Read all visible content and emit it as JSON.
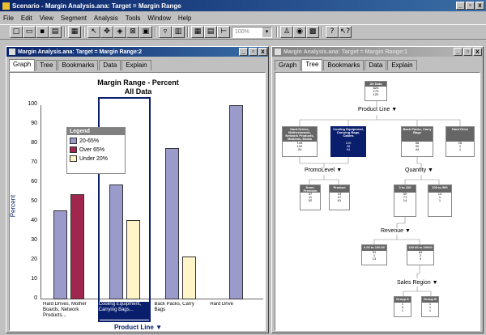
{
  "app": {
    "title": "Scenario - Margin Analysis.ana:  Target = Margin Range",
    "min": "_",
    "max": "▫",
    "close": "x"
  },
  "menu": [
    "File",
    "Edit",
    "View",
    "Segment",
    "Analysis",
    "Tools",
    "Window",
    "Help"
  ],
  "toolbar": {
    "zoom_value": "100%",
    "icons": [
      "new-icon",
      "open-icon",
      "save-icon",
      "print-icon",
      "copy-icon",
      "pointer-icon",
      "navigate-icon",
      "fit-icon",
      "zoom-icon",
      "image-icon",
      "filter-icon",
      "chart-icon",
      "grid-icon",
      "table-icon",
      "tree-icon",
      "people-icon",
      "target-icon",
      "analyze-icon",
      "help-icon",
      "context-help-icon"
    ]
  },
  "left": {
    "title": "Margin Analysis.ana:  Target = Margin Range:2",
    "tabs": [
      "Graph",
      "Tree",
      "Bookmarks",
      "Data",
      "Explain"
    ],
    "active_tab": "Graph",
    "chart_title": "Margin Range - Percent",
    "chart_subtitle": "All Data"
  },
  "right": {
    "title": "Margin Analysis.ana:  Target = Margin Range:1",
    "tabs": [
      "Graph",
      "Tree",
      "Bookmarks",
      "Data",
      "Explain"
    ],
    "active_tab": "Tree",
    "tree": {
      "root": {
        "title": "All Data",
        "v": [
          "824",
          "170",
          "120"
        ]
      },
      "split1": "Product Line",
      "n1": {
        "title": "Hard Drives, Motherboards, Network Products, Modems, Media Hardware",
        "v": [
          "144",
          "102",
          "24"
        ]
      },
      "n2": {
        "title": "Cooling Equipment, Carrying Bags, Cables",
        "v": [
          "120",
          "38",
          "94"
        ]
      },
      "n3": {
        "title": "Back Packs, Carry Bags",
        "v": [
          "56",
          "00",
          "44"
        ]
      },
      "n4": {
        "title": "Hard Drive",
        "v": [
          "26",
          "1",
          "1"
        ]
      },
      "split2a": "PromoLevel",
      "split2b": "Quantity",
      "n5": {
        "title": "None, Premium",
        "v": [
          "37",
          "11",
          "52"
        ]
      },
      "n6": {
        "title": "Product",
        "v": [
          "13",
          "27",
          "61"
        ]
      },
      "n7": {
        "title": "0 to 100",
        "v": [
          "50",
          "71",
          "14"
        ]
      },
      "n8": {
        "title": "100 to 500",
        "v": [
          "14",
          "1",
          "1"
        ]
      },
      "split3": "Revenue",
      "n9": {
        "title": "0.00 to 100.00",
        "v": [
          "51",
          "1",
          "14"
        ]
      },
      "n10": {
        "title": "100.00 to 20000",
        "v": [
          "64",
          "2",
          "4"
        ]
      },
      "split4": "Sales Region",
      "n11": {
        "title": "Group A",
        "v": [
          "1",
          "3",
          "1"
        ]
      },
      "n12": {
        "title": "Group B",
        "v": [
          "1",
          "1",
          "1"
        ]
      }
    }
  },
  "chart_data": {
    "type": "bar",
    "categories": [
      "Hard Drives, Mother Boards, Network Products...",
      "Cooling Equipment, Carrying Bags...",
      "Back Packs, Carry Bags",
      "Hard Drive"
    ],
    "series": [
      {
        "name": "20-65%",
        "color": "#9a9acb",
        "values": [
          46,
          59,
          78,
          100
        ]
      },
      {
        "name": "Over 65%",
        "color": "#a0264e",
        "values": [
          54,
          0,
          0,
          0
        ]
      },
      {
        "name": "Under 20%",
        "color": "#fff5c8",
        "values": [
          0,
          41,
          22,
          0
        ]
      }
    ],
    "xlabel": "Product Line",
    "ylabel": "Percent",
    "ylim": [
      0,
      100
    ],
    "yticks": [
      "100",
      "90",
      "80",
      "70",
      "60",
      "50",
      "40",
      "30",
      "20",
      "10",
      "0"
    ],
    "legend_title": "Legend",
    "legend_placement": "top-left",
    "highlighted_category": 1,
    "grid": false
  }
}
